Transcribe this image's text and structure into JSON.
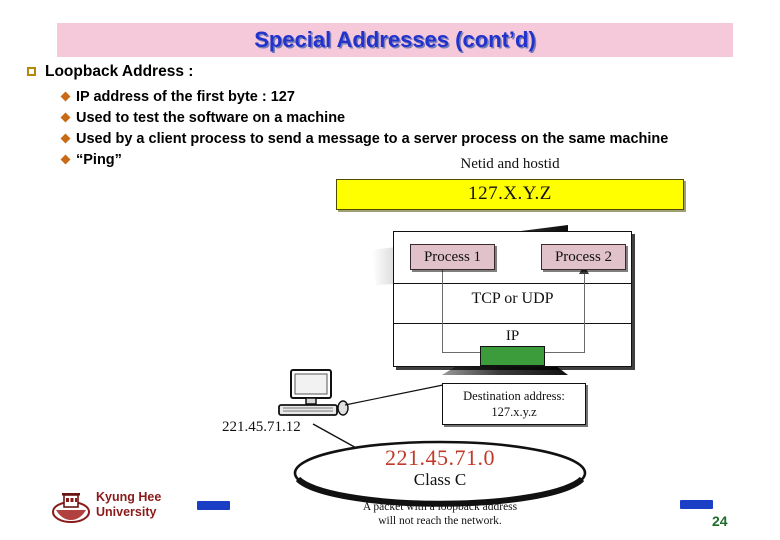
{
  "slide": {
    "title": "Special Addresses (cont’d)",
    "title_color": "#2233cc",
    "banner_color": "#f5c9da",
    "page_number": "24"
  },
  "bullets": {
    "level1": "Loopback Address :",
    "level2": [
      "IP address of the first byte : 127",
      "Used to test the software on a machine",
      "Used by a client process to send a message to a server process on the same machine",
      "“Ping”"
    ]
  },
  "diagram": {
    "netid_label": "Netid and hostid",
    "address_box": "127.X.Y.Z",
    "address_box_color": "#ffff00",
    "process_1": "Process 1",
    "process_2": "Process 2",
    "transport_layer": "TCP or UDP",
    "network_layer": "IP",
    "loopback_block_color": "#3c9c3c",
    "destination_line1": "Destination address:",
    "destination_line2": "127.x.y.z",
    "host_address": "221.45.71.12",
    "network_address": "221.45.71.0",
    "network_address_color": "#c0392b",
    "network_class": "Class C",
    "caption_line1": "A packet with a loopback address",
    "caption_line2": "will not reach the network."
  },
  "footer": {
    "university_line1": "Kyung Hee",
    "university_line2": "University",
    "university_color": "#8b1a1a",
    "accent_bar_color": "#1b3fc4"
  }
}
